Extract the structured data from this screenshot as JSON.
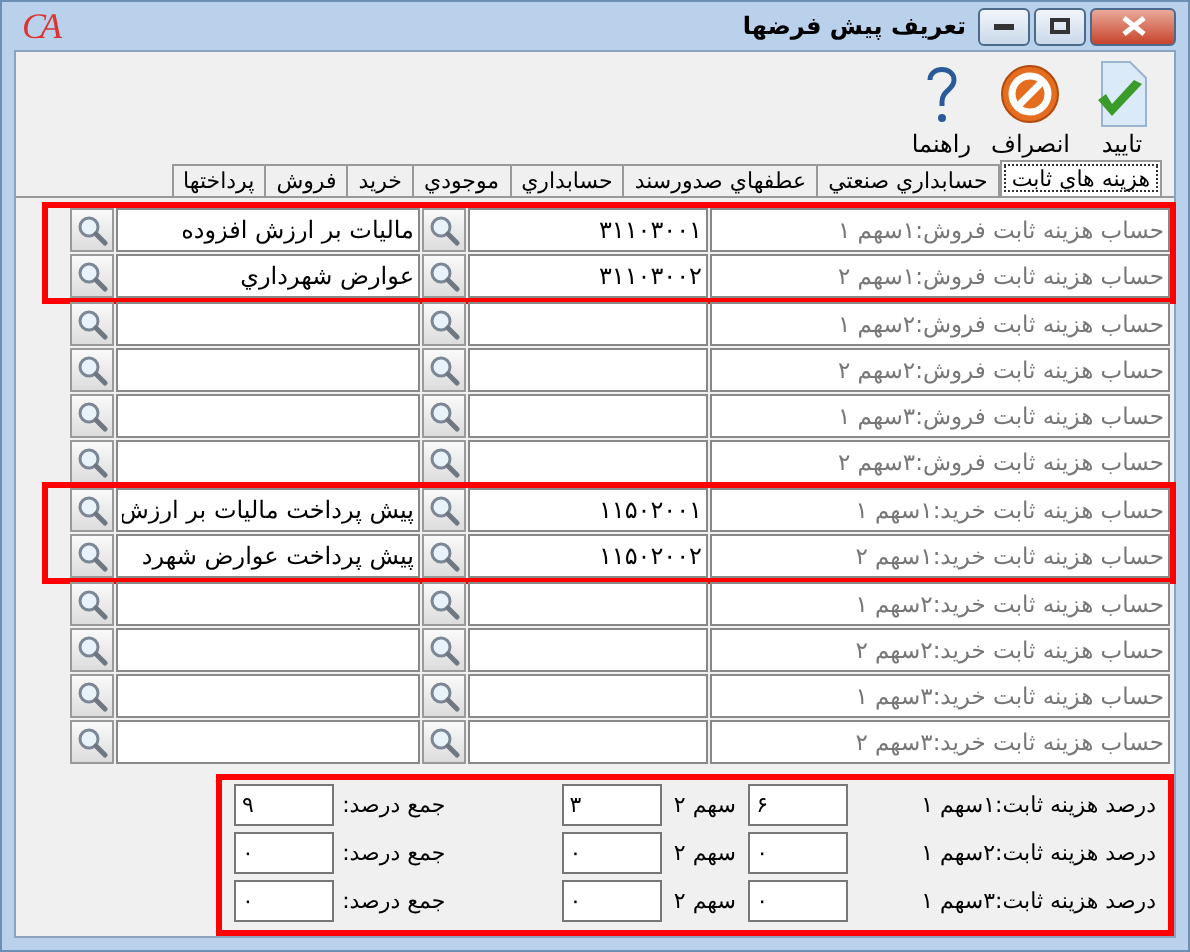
{
  "window": {
    "logo": "CA",
    "title": "تعريف پيش فرضها"
  },
  "toolbar": [
    {
      "kind": "confirm",
      "label": "تاييد"
    },
    {
      "kind": "cancel",
      "label": "انصراف"
    },
    {
      "kind": "help",
      "label": "راهنما"
    }
  ],
  "tabs": [
    {
      "label": "هزينه هاي ثابت",
      "selected": true
    },
    {
      "label": "حسابداري صنعتي",
      "selected": false
    },
    {
      "label": "عطفهاي صدورسند",
      "selected": false
    },
    {
      "label": "حسابداري",
      "selected": false
    },
    {
      "label": "موجودي",
      "selected": false
    },
    {
      "label": "خريد",
      "selected": false
    },
    {
      "label": "فروش",
      "selected": false
    },
    {
      "label": "پرداختها",
      "selected": false
    }
  ],
  "row_groups": [
    {
      "highlighted": true,
      "rows": [
        {
          "label": "حساب هزينه ثابت فروش:۱سهم ۱",
          "code": "۳۱۱۰۳۰۰۱",
          "name": "ماليات بر ارزش افزوده"
        },
        {
          "label": "حساب هزينه ثابت فروش:۱سهم ۲",
          "code": "۳۱۱۰۳۰۰۲",
          "name": "عوارض شهرداري"
        }
      ]
    },
    {
      "highlighted": false,
      "rows": [
        {
          "label": "حساب هزينه ثابت فروش:۲سهم ۱"
        },
        {
          "label": "حساب هزينه ثابت فروش:۲سهم ۲"
        },
        {
          "label": "حساب هزينه ثابت فروش:۳سهم ۱"
        },
        {
          "label": "حساب هزينه ثابت فروش:۳سهم ۲"
        }
      ]
    },
    {
      "highlighted": true,
      "rows": [
        {
          "label": "حساب هزينه ثابت خريد:۱سهم ۱",
          "code": "۱۱۵۰۲۰۰۱",
          "name": "پيش پرداخت ماليات بر ارزش"
        },
        {
          "label": "حساب هزينه ثابت خريد:۱سهم ۲",
          "code": "۱۱۵۰۲۰۰۲",
          "name": "پيش پرداخت عوارض شهرد"
        }
      ]
    },
    {
      "highlighted": false,
      "rows": [
        {
          "label": "حساب هزينه ثابت خريد:۲سهم ۱"
        },
        {
          "label": "حساب هزينه ثابت خريد:۲سهم ۲"
        },
        {
          "label": "حساب هزينه ثابت خريد:۳سهم ۱"
        },
        {
          "label": "حساب هزينه ثابت خريد:۳سهم ۲"
        }
      ]
    }
  ],
  "percentages": {
    "highlighted": true,
    "rows": [
      {
        "label": "درصد هزينه ثابت:۱سهم ۱",
        "share_1": "۶",
        "share_2_label": "سهم ۲",
        "share_2": "۳",
        "total_label": "جمع درصد:",
        "total": "۹"
      },
      {
        "label": "درصد هزينه ثابت:۲سهم ۱",
        "share_1": "۰",
        "share_2_label": "سهم ۲",
        "share_2": "۰",
        "total_label": "جمع درصد:",
        "total": "۰"
      },
      {
        "label": "درصد هزينه ثابت:۳سهم ۱",
        "share_1": "۰",
        "share_2_label": "سهم ۲",
        "share_2": "۰",
        "total_label": "جمع درصد:",
        "total": "۰"
      }
    ]
  }
}
